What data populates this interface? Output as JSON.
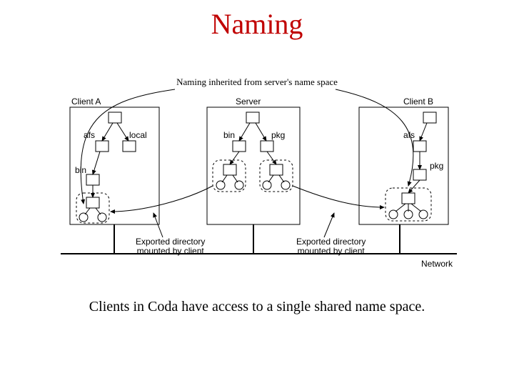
{
  "title": "Naming",
  "subtitle": "Naming inherited from server's name space",
  "caption": "Clients in Coda have access to a single shared name space.",
  "labels": {
    "clientA": "Client A",
    "server": "Server",
    "clientB": "Client B",
    "afs": "afs",
    "local": "local",
    "bin": "bin",
    "pkg": "pkg",
    "exported": "Exported directory\nmounted by client",
    "network": "Network"
  },
  "chart_data": {
    "type": "diagram",
    "entities": [
      {
        "name": "Client A",
        "tree": [
          "root",
          "afs",
          "local",
          "bin",
          "exported-subtree"
        ]
      },
      {
        "name": "Server",
        "tree": [
          "root",
          "bin",
          "pkg",
          "bin-subtree",
          "pkg-subtree"
        ]
      },
      {
        "name": "Client B",
        "tree": [
          "root",
          "afs",
          "pkg",
          "exported-subtree"
        ]
      }
    ],
    "edges": [
      {
        "from": "Server.bin-subtree",
        "to": "ClientA.exported-subtree",
        "label": "Exported directory mounted by client"
      },
      {
        "from": "Server.pkg-subtree",
        "to": "ClientB.exported-subtree",
        "label": "Exported directory mounted by client"
      }
    ],
    "note": "Naming inherited from server's name space",
    "baseline": "Network"
  }
}
